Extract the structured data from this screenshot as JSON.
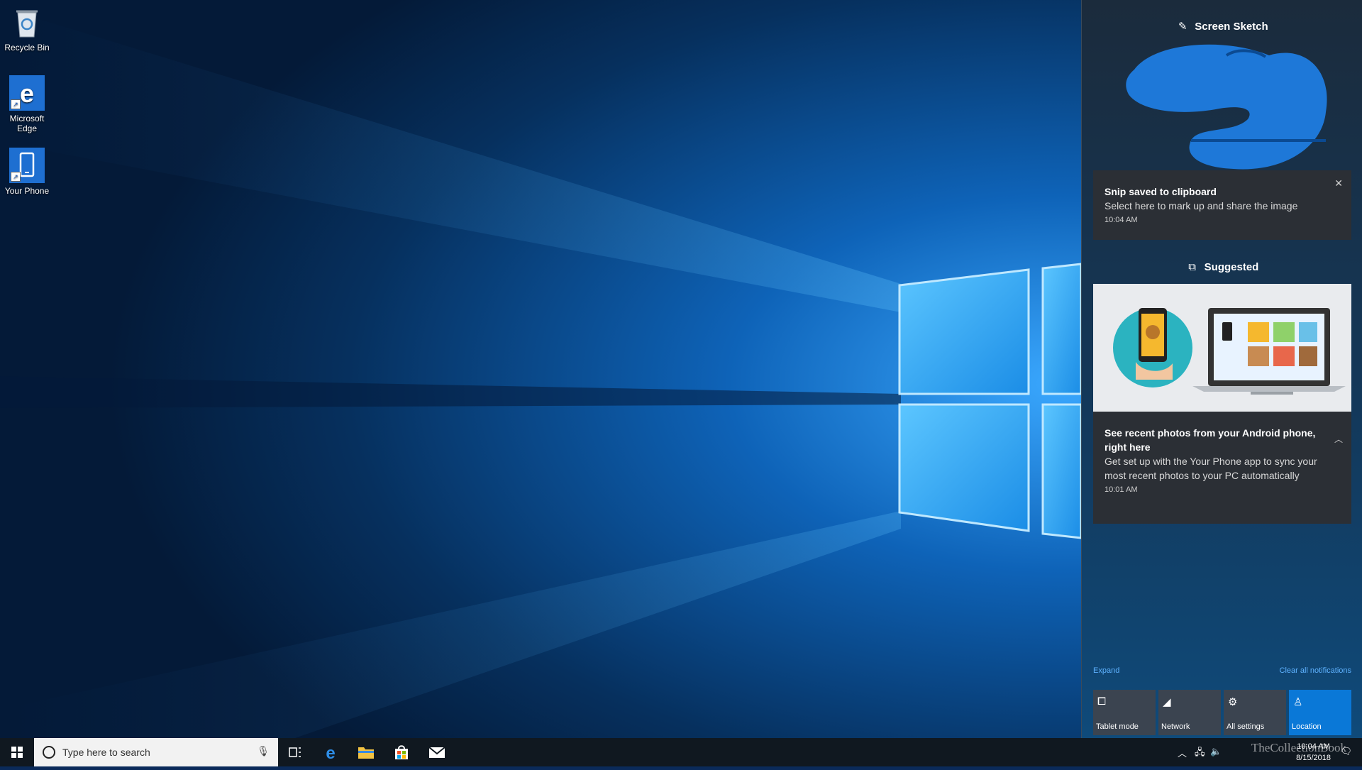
{
  "desktop": {
    "icons": [
      {
        "label": "Recycle Bin"
      },
      {
        "label": "Microsoft\nEdge"
      },
      {
        "label": "Your Phone"
      }
    ]
  },
  "action_center": {
    "screen_sketch": {
      "group_title": "Screen Sketch",
      "notification": {
        "title": "Snip saved to clipboard",
        "body": "Select here to mark up and share the image",
        "time": "10:04 AM",
        "close_icon": "close-icon"
      }
    },
    "suggested": {
      "group_title": "Suggested",
      "notification": {
        "title": "See recent photos from your Android phone, right here",
        "body": "Get set up with the Your Phone app to sync your most recent photos to your PC automatically",
        "time": "10:01 AM"
      }
    },
    "expand_label": "Expand",
    "clear_label": "Clear all notifications",
    "quick_actions": [
      {
        "label": "Tablet mode",
        "icon": "tablet-mode-icon",
        "on": false
      },
      {
        "label": "Network",
        "icon": "network-icon",
        "on": false
      },
      {
        "label": "All settings",
        "icon": "gear-icon",
        "on": false
      },
      {
        "label": "Location",
        "icon": "location-icon",
        "on": true
      }
    ]
  },
  "taskbar": {
    "search_placeholder": "Type here to search",
    "clock_time": "10:04 AM",
    "clock_date": "8/15/2018",
    "watermark": "TheCollectionBook"
  },
  "colors": {
    "accent": "#0a78d7",
    "link": "#5fb2ff",
    "card": "#2b2f35",
    "taskbar": "#101820"
  }
}
